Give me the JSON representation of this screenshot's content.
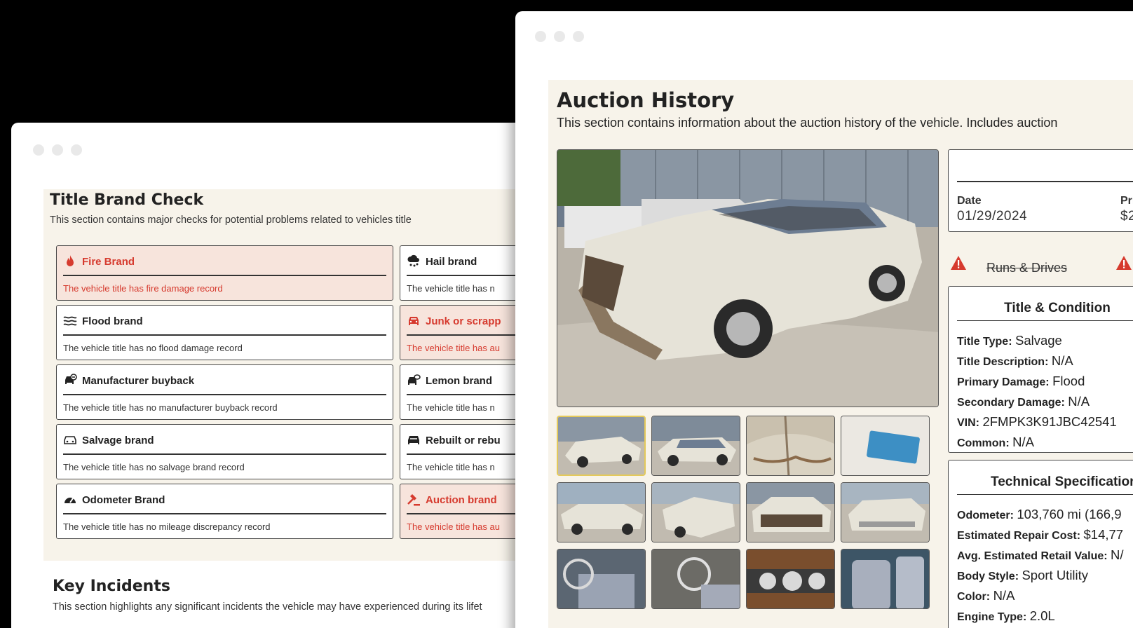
{
  "title_brand_check": {
    "title": "Title Brand Check",
    "subtitle": "This section contains major checks for potential problems related to vehicles title",
    "left_column": [
      {
        "name": "Fire Brand",
        "desc": "The vehicle title has fire damage record",
        "alert": true,
        "icon": "fire-icon"
      },
      {
        "name": "Flood brand",
        "desc": "The vehicle title has no flood damage record",
        "alert": false,
        "icon": "waves-icon"
      },
      {
        "name": "Manufacturer buyback",
        "desc": "The vehicle title has no manufacturer buyback record",
        "alert": false,
        "icon": "car-return-icon"
      },
      {
        "name": "Salvage brand",
        "desc": "The vehicle title has no salvage brand record",
        "alert": false,
        "icon": "car-icon"
      },
      {
        "name": "Odometer Brand",
        "desc": "The vehicle title has no mileage discrepancy record",
        "alert": false,
        "icon": "speedometer-icon"
      }
    ],
    "right_column": [
      {
        "name": "Hail brand",
        "desc": "The vehicle title has n",
        "alert": false,
        "icon": "hail-cloud-icon"
      },
      {
        "name": "Junk or scrapp",
        "desc": "The vehicle title has au",
        "alert": true,
        "icon": "junk-car-icon"
      },
      {
        "name": "Lemon brand",
        "desc": "The vehicle title has n",
        "alert": false,
        "icon": "lemon-car-icon"
      },
      {
        "name": "Rebuilt or rebu",
        "desc": "The vehicle title has n",
        "alert": false,
        "icon": "rebuilt-car-icon"
      },
      {
        "name": "Auction brand",
        "desc": "The vehicle title has au",
        "alert": true,
        "icon": "gavel-icon"
      }
    ]
  },
  "key_incidents": {
    "title": "Key Incidents",
    "subtitle": "This section highlights any significant incidents the vehicle may have experienced during its lifet"
  },
  "auction_history": {
    "title": "Auction History",
    "subtitle": "This section contains information about the auction history of the vehicle. Includes auction",
    "sale": {
      "date_label": "Date",
      "date_value": "01/29/2024",
      "price_label": "Pri",
      "price_value": "$2"
    },
    "runs_drives": "Runs & Drives",
    "title_condition": {
      "heading": "Title & Condition",
      "rows": [
        {
          "k": "Title Type:",
          "v": "Salvage"
        },
        {
          "k": "Title Description:",
          "v": "N/A"
        },
        {
          "k": "Primary Damage:",
          "v": "Flood"
        },
        {
          "k": "Secondary Damage:",
          "v": "N/A"
        },
        {
          "k": "VIN:",
          "v": "2FMPK3K91JBC42541"
        },
        {
          "k": "Common:",
          "v": "N/A"
        }
      ]
    },
    "technical": {
      "heading": "Technical Specification",
      "rows": [
        {
          "k": "Odometer:",
          "v": "103,760 mi (166,9"
        },
        {
          "k": "Estimated Repair Cost:",
          "v": "$14,77"
        },
        {
          "k": "Avg. Estimated Retail Value:",
          "v": "N/"
        },
        {
          "k": "Body Style:",
          "v": "Sport Utility"
        },
        {
          "k": "Color:",
          "v": "N/A"
        },
        {
          "k": "Engine Type:",
          "v": "2.0L"
        }
      ]
    }
  },
  "colors": {
    "alert": "#d63a2e",
    "panel": "#f7f3ea",
    "alert_bg": "#f7e4dc"
  }
}
